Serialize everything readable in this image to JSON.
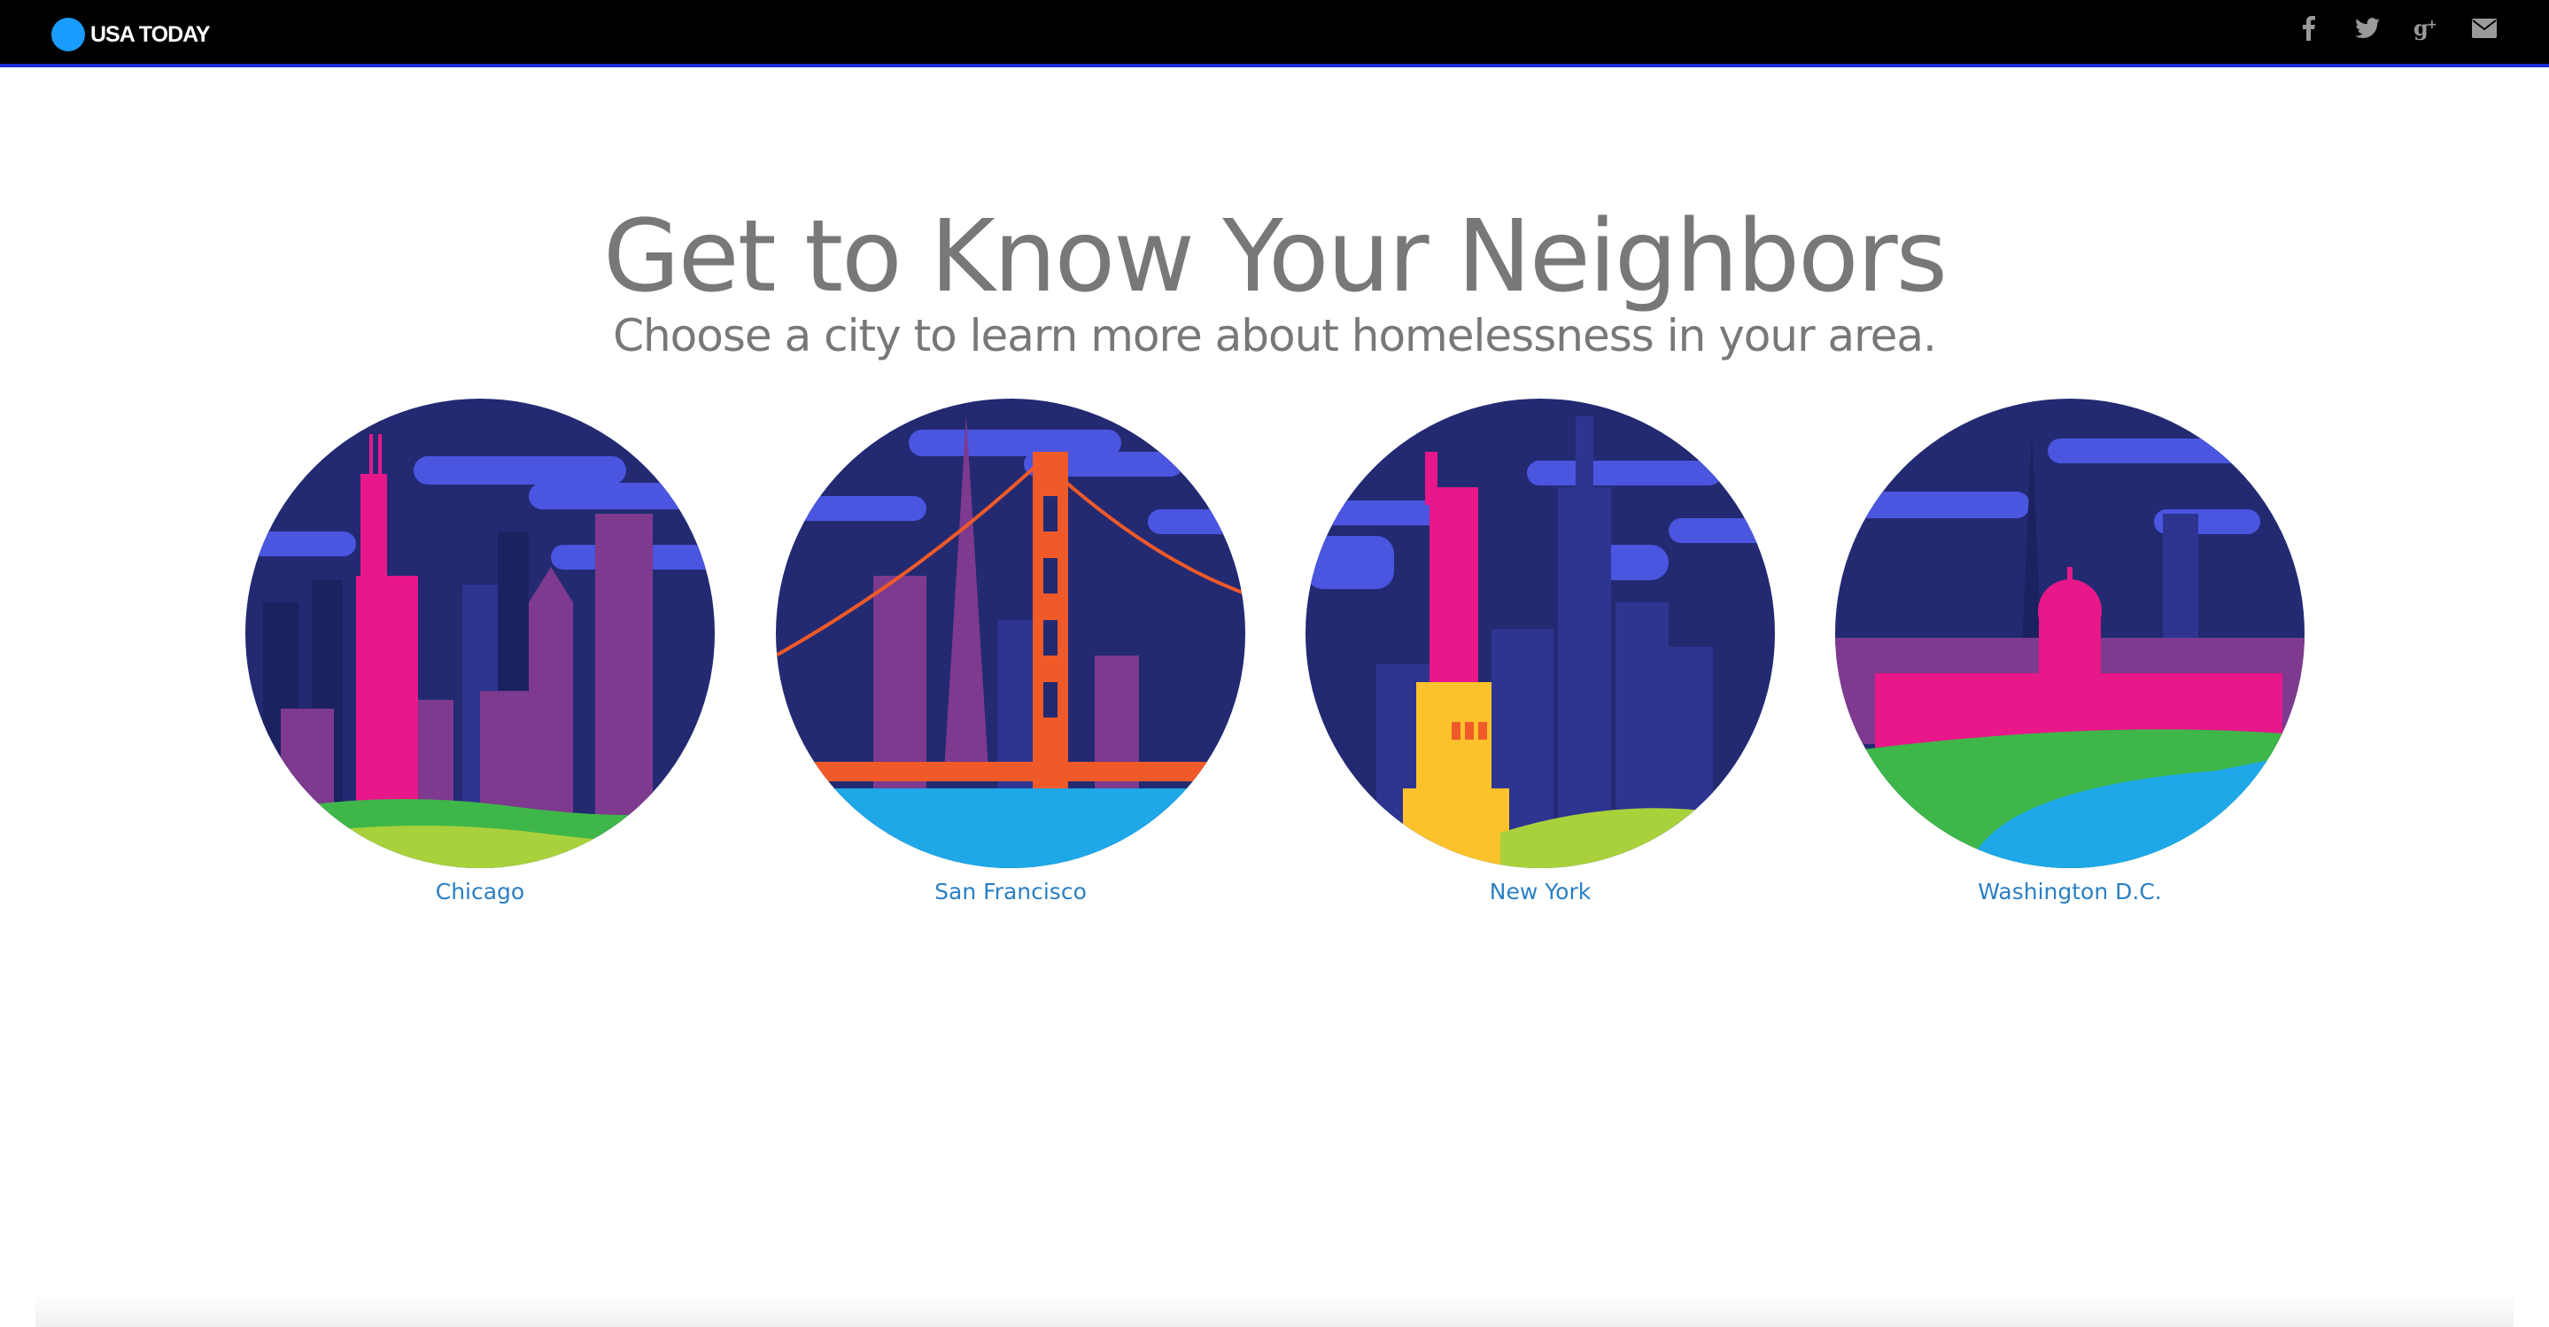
{
  "header": {
    "brand": "USA TODAY",
    "social": [
      {
        "icon": "facebook-icon",
        "glyph": "f"
      },
      {
        "icon": "twitter-icon",
        "glyph": "🐦"
      },
      {
        "icon": "google-plus-icon",
        "glyph": "g+"
      },
      {
        "icon": "email-icon",
        "glyph": "✉"
      }
    ]
  },
  "main": {
    "title": "Get to Know Your Neighbors",
    "subtitle": "Choose a city to learn more about homelessness in your area."
  },
  "cities": [
    {
      "label": "Chicago"
    },
    {
      "label": "San Francisco"
    },
    {
      "label": "New York"
    },
    {
      "label": "Washington D.C."
    }
  ],
  "colors": {
    "sky": "#232a72",
    "cloud": "#4a55e0",
    "pink": "#e8178a",
    "purple": "#7d3a8e",
    "green": "#3fb649",
    "lime": "#a8d13c",
    "water": "#1ea8e8",
    "orange": "#f05a28",
    "yellow": "#fcc22c",
    "link": "#2a7fc4",
    "accent_bar": "#1a2fd6"
  }
}
